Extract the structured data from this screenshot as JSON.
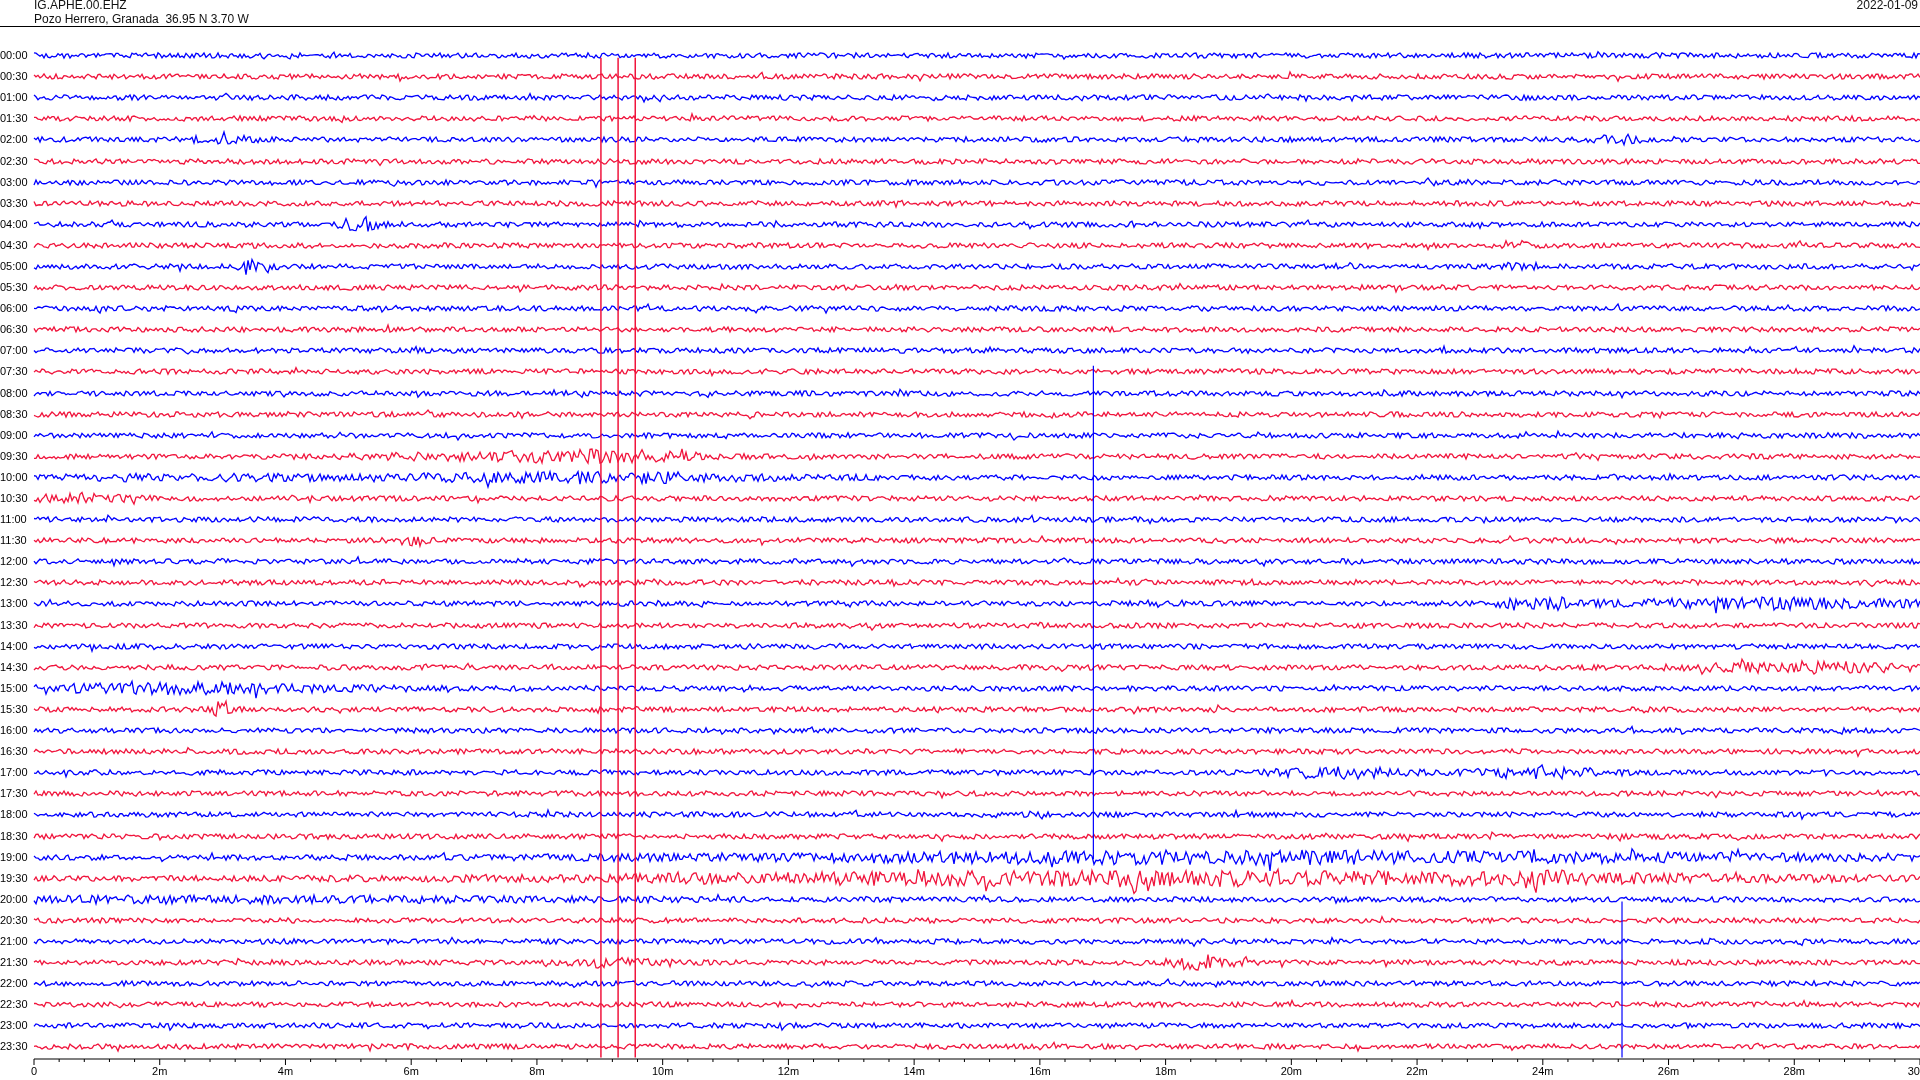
{
  "header": {
    "station": "IG.APHE.00.EHZ",
    "location": "Pozo Herrero, Granada  36.95 N 3.70 W",
    "date": "2022-01-09"
  },
  "rows": [
    {
      "time": "00:00",
      "color": "#0000ff"
    },
    {
      "time": "00:30",
      "color": "#f0143c"
    },
    {
      "time": "01:00",
      "color": "#0000ff"
    },
    {
      "time": "01:30",
      "color": "#f0143c"
    },
    {
      "time": "02:00",
      "color": "#0000ff"
    },
    {
      "time": "02:30",
      "color": "#f0143c"
    },
    {
      "time": "03:00",
      "color": "#0000ff"
    },
    {
      "time": "03:30",
      "color": "#f0143c"
    },
    {
      "time": "04:00",
      "color": "#0000ff"
    },
    {
      "time": "04:30",
      "color": "#f0143c"
    },
    {
      "time": "05:00",
      "color": "#0000ff"
    },
    {
      "time": "05:30",
      "color": "#f0143c"
    },
    {
      "time": "06:00",
      "color": "#0000ff"
    },
    {
      "time": "06:30",
      "color": "#f0143c"
    },
    {
      "time": "07:00",
      "color": "#0000ff"
    },
    {
      "time": "07:30",
      "color": "#f0143c"
    },
    {
      "time": "08:00",
      "color": "#0000ff"
    },
    {
      "time": "08:30",
      "color": "#f0143c"
    },
    {
      "time": "09:00",
      "color": "#0000ff"
    },
    {
      "time": "09:30",
      "color": "#f0143c"
    },
    {
      "time": "10:00",
      "color": "#0000ff"
    },
    {
      "time": "10:30",
      "color": "#f0143c"
    },
    {
      "time": "11:00",
      "color": "#0000ff"
    },
    {
      "time": "11:30",
      "color": "#f0143c"
    },
    {
      "time": "12:00",
      "color": "#0000ff"
    },
    {
      "time": "12:30",
      "color": "#f0143c"
    },
    {
      "time": "13:00",
      "color": "#0000ff"
    },
    {
      "time": "13:30",
      "color": "#f0143c"
    },
    {
      "time": "14:00",
      "color": "#0000ff"
    },
    {
      "time": "14:30",
      "color": "#f0143c"
    },
    {
      "time": "15:00",
      "color": "#0000ff"
    },
    {
      "time": "15:30",
      "color": "#f0143c"
    },
    {
      "time": "16:00",
      "color": "#0000ff"
    },
    {
      "time": "16:30",
      "color": "#f0143c"
    },
    {
      "time": "17:00",
      "color": "#0000ff"
    },
    {
      "time": "17:30",
      "color": "#f0143c"
    },
    {
      "time": "18:00",
      "color": "#0000ff"
    },
    {
      "time": "18:30",
      "color": "#f0143c"
    },
    {
      "time": "19:00",
      "color": "#0000ff"
    },
    {
      "time": "19:30",
      "color": "#f0143c"
    },
    {
      "time": "20:00",
      "color": "#0000ff"
    },
    {
      "time": "20:30",
      "color": "#f0143c"
    },
    {
      "time": "21:00",
      "color": "#0000ff"
    },
    {
      "time": "21:30",
      "color": "#f0143c"
    },
    {
      "time": "22:00",
      "color": "#0000ff"
    },
    {
      "time": "22:30",
      "color": "#f0143c"
    },
    {
      "time": "23:00",
      "color": "#0000ff"
    },
    {
      "time": "23:30",
      "color": "#f0143c"
    }
  ],
  "x_axis": {
    "labels": [
      "0",
      "2m",
      "4m",
      "6m",
      "8m",
      "10m",
      "12m",
      "14m",
      "16m",
      "18m",
      "20m",
      "22m",
      "24m",
      "26m",
      "28m",
      "30"
    ]
  }
}
